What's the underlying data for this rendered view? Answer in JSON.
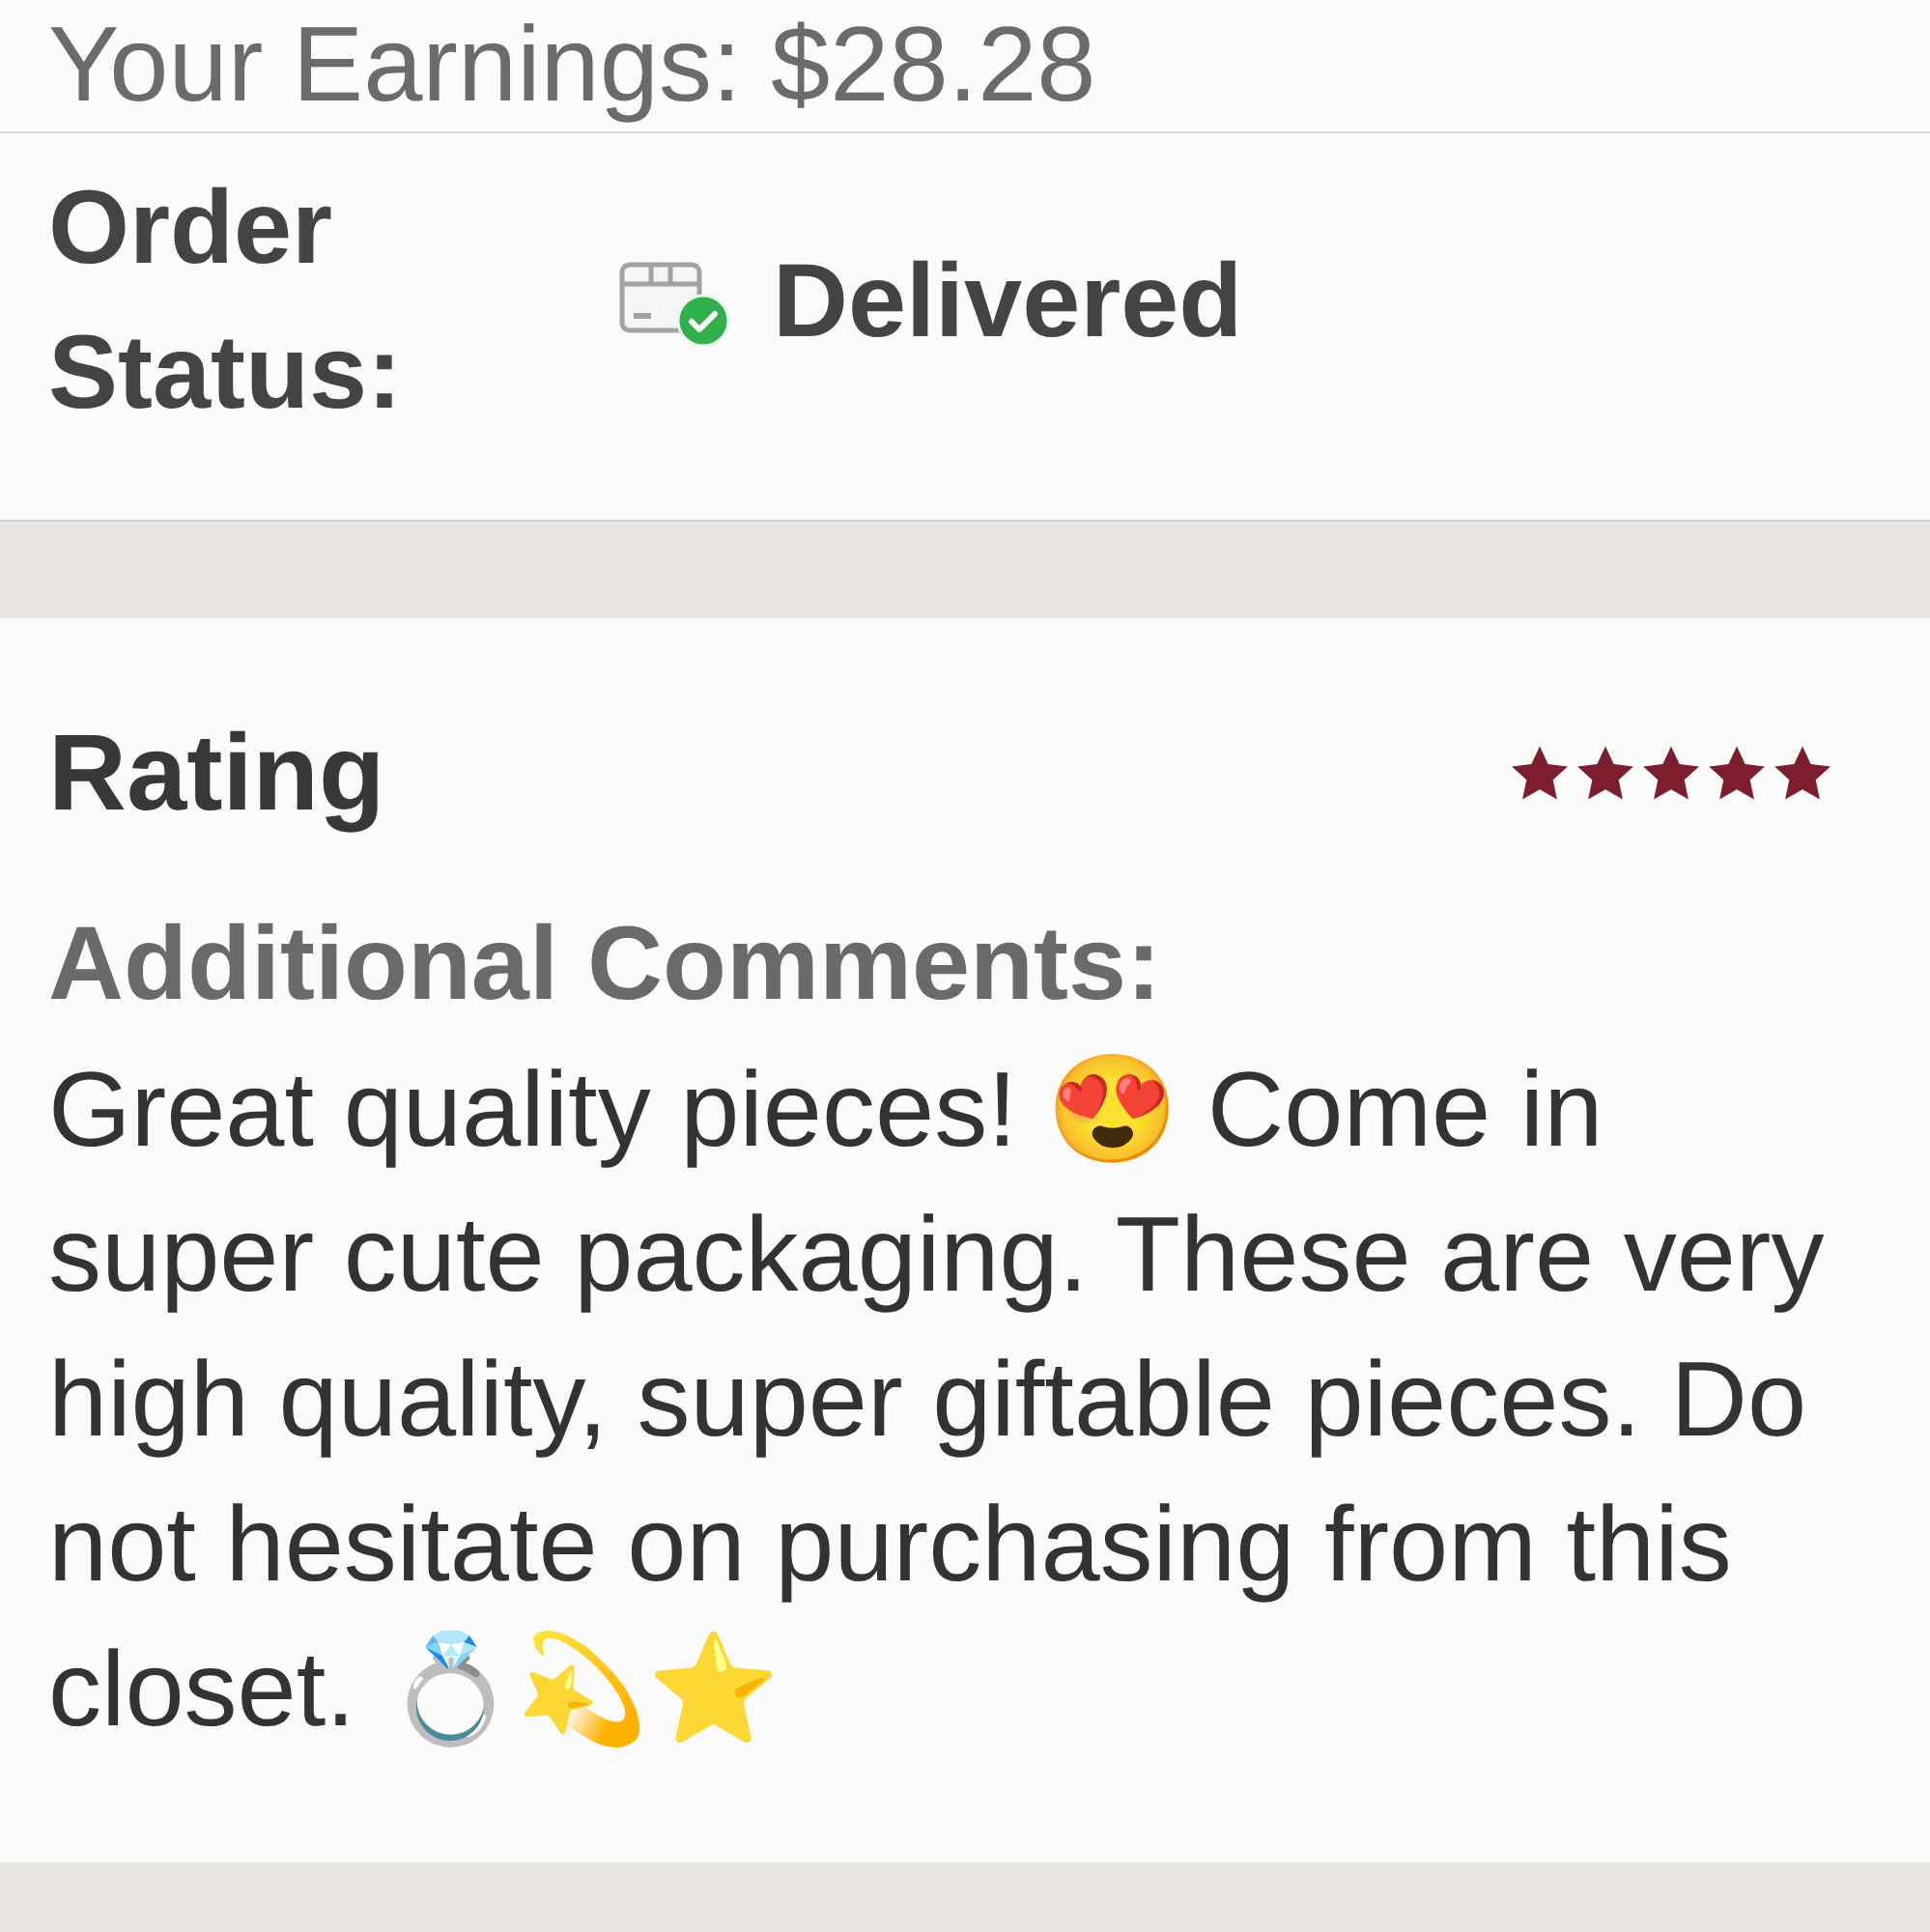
{
  "earnings": {
    "label": "Your Earnings: $28.28"
  },
  "order_status": {
    "label": "Order Status:",
    "value": "Delivered"
  },
  "rating": {
    "label": "Rating",
    "stars": 5
  },
  "comments": {
    "label": "Additional Comments:",
    "text": "Great quality pieces! 😍 Come in super cute packaging. These are very high quality, super giftable pieces. Do not hesitate on purchasing from this closet. 💍💫⭐"
  }
}
